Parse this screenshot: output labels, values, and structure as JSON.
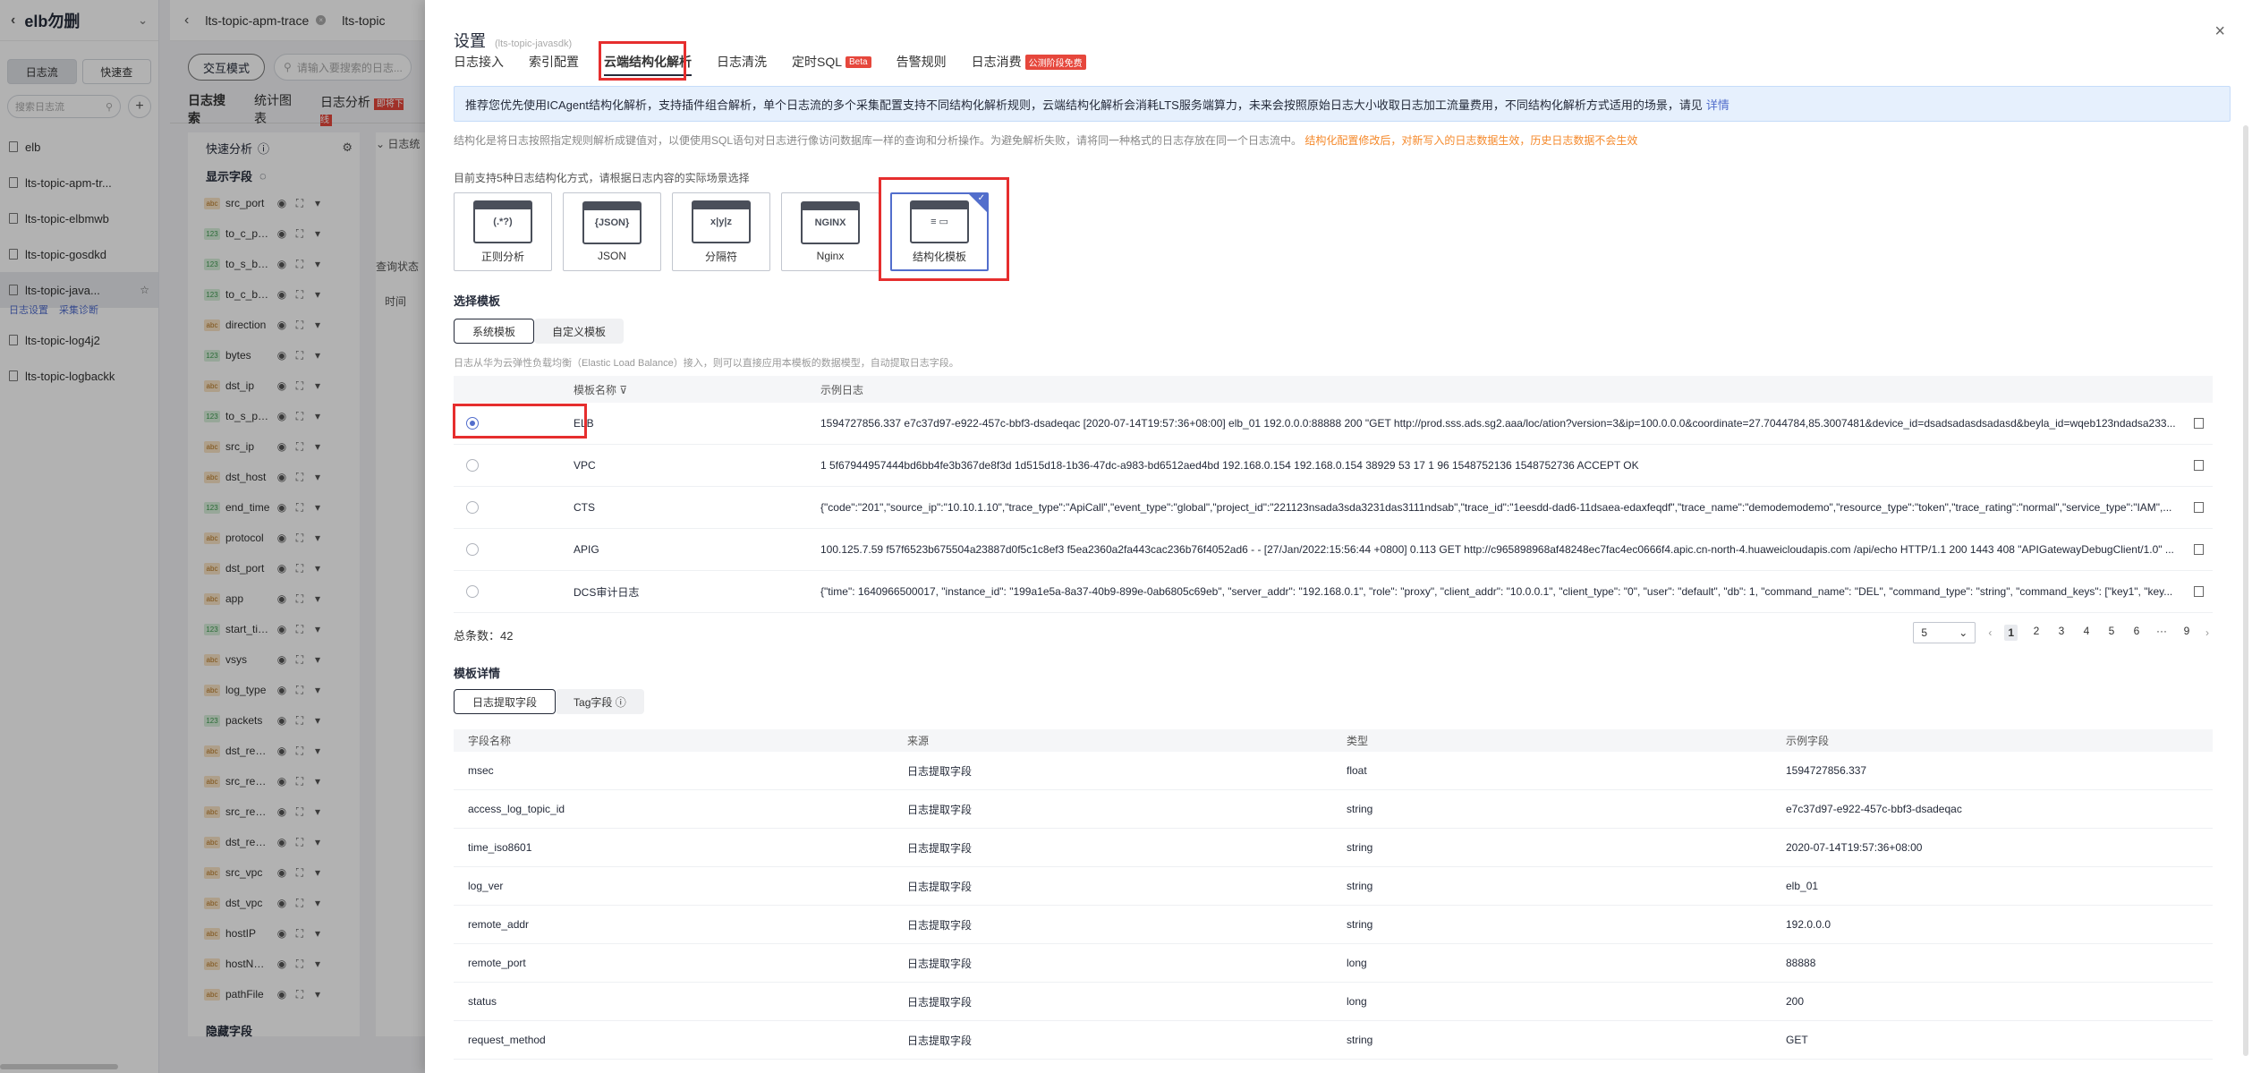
{
  "left_nav": {
    "group_title": "elb勿删",
    "tabs": [
      "日志流",
      "快速查"
    ],
    "search_placeholder": "搜索日志流",
    "streams": [
      {
        "label": "elb"
      },
      {
        "label": "lts-topic-apm-tr..."
      },
      {
        "label": "lts-topic-elbmwb"
      },
      {
        "label": "lts-topic-gosdkd"
      },
      {
        "label": "lts-topic-java..."
      },
      {
        "label": "lts-topic-log4j2"
      },
      {
        "label": "lts-topic-logbackk"
      }
    ],
    "active_sub_links": [
      "日志设置",
      "采集诊断"
    ]
  },
  "workspace": {
    "tabs": [
      "lts-topic-apm-trace",
      "lts-topic"
    ],
    "mode_button": "交互模式",
    "search_placeholder": "请输入要搜索的日志...",
    "sub_tabs": [
      "日志搜索",
      "统计图表",
      "日志分析"
    ],
    "new_badge": "即将下线",
    "quick_analysis": "快速分析",
    "display_fields": "显示字段",
    "hidden_fields": "隐藏字段",
    "query_status": "查询状态",
    "time_label": "时间",
    "log_label": "日志",
    "fields": [
      {
        "name": "src_port",
        "type": "abc"
      },
      {
        "name": "to_c_pkts",
        "type": "123"
      },
      {
        "name": "to_s_by...",
        "type": "123"
      },
      {
        "name": "to_c_by...",
        "type": "123"
      },
      {
        "name": "direction",
        "type": "abc"
      },
      {
        "name": "bytes",
        "type": "123"
      },
      {
        "name": "dst_ip",
        "type": "abc"
      },
      {
        "name": "to_s_pkts",
        "type": "123"
      },
      {
        "name": "src_ip",
        "type": "abc"
      },
      {
        "name": "dst_host",
        "type": "abc"
      },
      {
        "name": "end_time",
        "type": "123"
      },
      {
        "name": "protocol",
        "type": "abc"
      },
      {
        "name": "dst_port",
        "type": "abc"
      },
      {
        "name": "app",
        "type": "abc"
      },
      {
        "name": "start_time",
        "type": "123"
      },
      {
        "name": "vsys",
        "type": "abc"
      },
      {
        "name": "log_type",
        "type": "abc"
      },
      {
        "name": "packets",
        "type": "123"
      },
      {
        "name": "dst_regi...",
        "type": "abc"
      },
      {
        "name": "src_regi...",
        "type": "abc"
      },
      {
        "name": "src_regi...",
        "type": "abc"
      },
      {
        "name": "dst_regi...",
        "type": "abc"
      },
      {
        "name": "src_vpc",
        "type": "abc"
      },
      {
        "name": "dst_vpc",
        "type": "abc"
      },
      {
        "name": "hostIP",
        "type": "abc"
      },
      {
        "name": "hostName",
        "type": "abc"
      },
      {
        "name": "pathFile",
        "type": "abc"
      }
    ]
  },
  "drawer": {
    "title": "设置",
    "subtitle": "(lts-topic-javasdk)",
    "tabs": [
      {
        "label": "日志接入",
        "badge": ""
      },
      {
        "label": "索引配置",
        "badge": ""
      },
      {
        "label": "云端结构化解析",
        "badge": ""
      },
      {
        "label": "日志清洗",
        "badge": ""
      },
      {
        "label": "定时SQL",
        "badge": "Beta"
      },
      {
        "label": "告警规则",
        "badge": ""
      },
      {
        "label": "日志消费",
        "badge": "公测阶段免费"
      }
    ],
    "banner_text": "推荐您优先使用ICAgent结构化解析，支持插件组合解析，单个日志流的多个采集配置支持不同结构化解析规则，云端结构化解析会消耗LTS服务端算力，未来会按照原始日志大小收取日志加工流量费用，不同结构化解析方式适用的场景，请见",
    "banner_link": "详情",
    "notice_text": "结构化是将日志按照指定规则解析成键值对，以便使用SQL语句对日志进行像访问数据库一样的查询和分析操作。为避免解析失败，请将同一种格式的日志存放在同一个日志流中。",
    "notice_warn": "结构化配置修改后，对新写入的日志数据生效，历史日志数据不会生效",
    "methods_intro": "目前支持5种日志结构化方式，请根据日志内容的实际场景选择",
    "methods": [
      {
        "label": "正则分析",
        "icon": "(.*?)"
      },
      {
        "label": "JSON",
        "icon": "{JSON}"
      },
      {
        "label": "分隔符",
        "icon": "x|y|z"
      },
      {
        "label": "Nginx",
        "icon": "NGINX"
      },
      {
        "label": "结构化模板",
        "icon": "≡ ▭"
      }
    ],
    "select_template": "选择模板",
    "template_tabs": [
      "系统模板",
      "自定义模板"
    ],
    "template_desc": "日志从华为云弹性负载均衡（Elastic Load Balance）接入，则可以直接应用本模板的数据模型，自动提取日志字段。",
    "template_columns": [
      "模板名称",
      "示例日志"
    ],
    "templates": [
      {
        "name": "ELB",
        "log": "1594727856.337 e7c37d97-e922-457c-bbf3-dsadeqac [2020-07-14T19:57:36+08:00] elb_01 192.0.0.0:88888 200 \"GET http://prod.sss.ads.sg2.aaa/loc/ation?version=3&ip=100.0.0.0&coordinate=27.7044784,85.3007481&device_id=dsadsadasdsadasd&beyla_id=wqeb123ndadsa233..."
      },
      {
        "name": "VPC",
        "log": "1 5f67944957444bd6bb4fe3b367de8f3d 1d515d18-1b36-47dc-a983-bd6512aed4bd 192.168.0.154 192.168.0.154 38929 53 17 1 96 1548752136 1548752736 ACCEPT OK"
      },
      {
        "name": "CTS",
        "log": "{\"code\":\"201\",\"source_ip\":\"10.10.1.10\",\"trace_type\":\"ApiCall\",\"event_type\":\"global\",\"project_id\":\"221123nsada3sda3231das3111ndsab\",\"trace_id\":\"1eesdd-dad6-11dsaea-edaxfeqdf\",\"trace_name\":\"demodemodemo\",\"resource_type\":\"token\",\"trace_rating\":\"normal\",\"service_type\":\"IAM\",..."
      },
      {
        "name": "APIG",
        "log": "100.125.7.59 f57f6523b675504a23887d0f5c1c8ef3 f5ea2360a2fa443cac236b76f4052ad6 - - [27/Jan/2022:15:56:44 +0800] 0.113 GET http://c965898968af48248ec7fac4ec0666f4.apic.cn-north-4.huaweicloudapis.com /api/echo HTTP/1.1 200 1443 408 \"APIGatewayDebugClient/1.0\" ..."
      },
      {
        "name": "DCS审计日志",
        "log": "{\"time\": 1640966500017, \"instance_id\": \"199a1e5a-8a37-40b9-899e-0ab6805c69eb\", \"server_addr\": \"192.168.0.1\", \"role\": \"proxy\", \"client_addr\": \"10.0.0.1\", \"client_type\": \"0\", \"user\": \"default\", \"db\": 1, \"command_name\": \"DEL\", \"command_type\": \"string\", \"command_keys\": [\"key1\", \"key..."
      }
    ],
    "total_label": "总条数：42",
    "page_size": "5",
    "pages": [
      "1",
      "2",
      "3",
      "4",
      "5",
      "6",
      "···",
      "9"
    ],
    "detail_title": "模板详情",
    "detail_tabs": [
      "日志提取字段",
      "Tag字段"
    ],
    "detail_columns": [
      "字段名称",
      "来源",
      "类型",
      "示例字段"
    ],
    "detail_rows": [
      [
        "msec",
        "日志提取字段",
        "float",
        "1594727856.337"
      ],
      [
        "access_log_topic_id",
        "日志提取字段",
        "string",
        "e7c37d97-e922-457c-bbf3-dsadeqac"
      ],
      [
        "time_iso8601",
        "日志提取字段",
        "string",
        "2020-07-14T19:57:36+08:00"
      ],
      [
        "log_ver",
        "日志提取字段",
        "string",
        "elb_01"
      ],
      [
        "remote_addr",
        "日志提取字段",
        "string",
        "192.0.0.0"
      ],
      [
        "remote_port",
        "日志提取字段",
        "long",
        "88888"
      ],
      [
        "status",
        "日志提取字段",
        "long",
        "200"
      ],
      [
        "request_method",
        "日志提取字段",
        "string",
        "GET"
      ]
    ]
  },
  "colors": {
    "accent": "#526ecc",
    "highlight": "#e62e2e",
    "banner_bg": "#e6f0fd",
    "warn": "#f5892b"
  }
}
